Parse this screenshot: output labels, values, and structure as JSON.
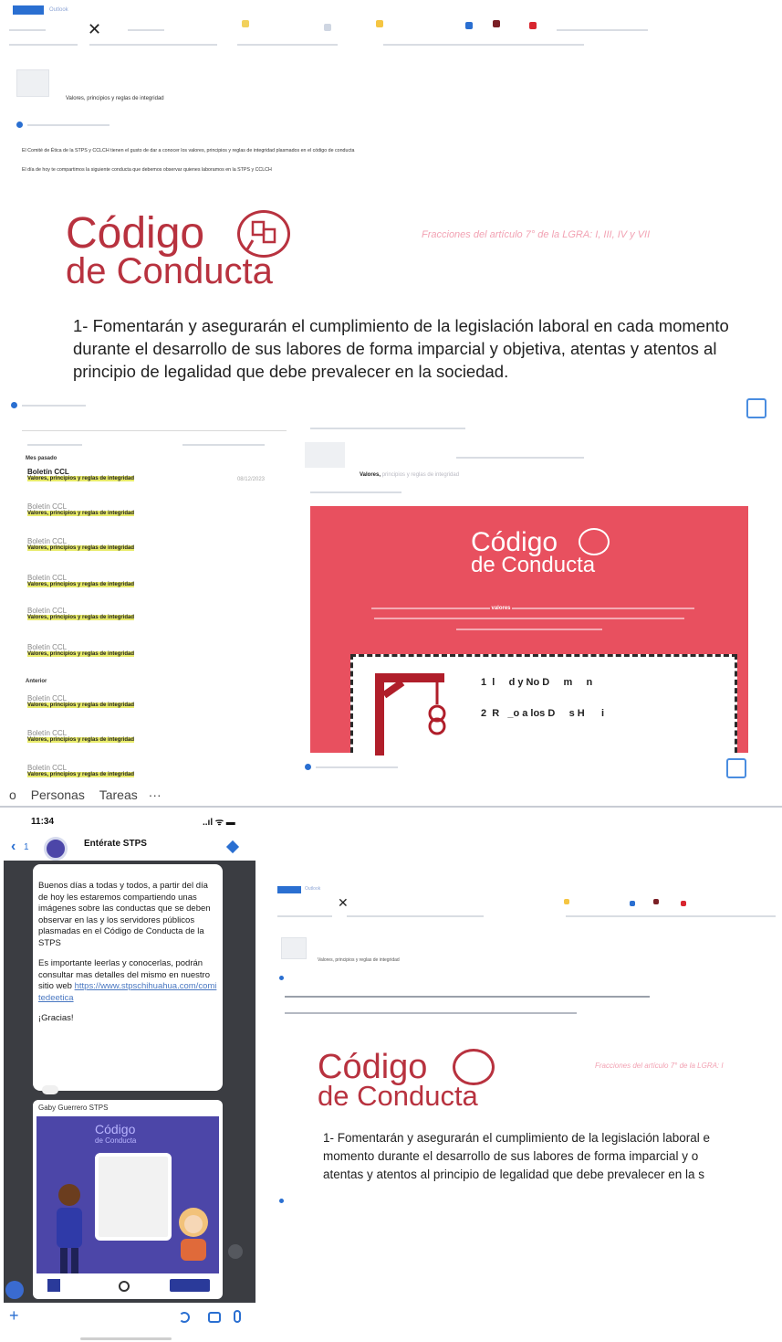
{
  "top_screenshot": {
    "app_badge": "Outlook",
    "ribbon_close": "✕",
    "email_subject": "Valores, principios y reglas de integridad",
    "body_line1": "El Comité de Ética de la STPS y CCLCH tienen el gusto de dar a conocer los valores, principios y reglas de integridad plasmados en el código de conducta",
    "body_line2": "El día de hoy te compartimos la siguiente conducta que debemos observar quienes laboramos en la STPS y CCLCH",
    "logo_line1": "Código",
    "logo_line2": "de Conducta",
    "fractions_note": "Fracciones del artículo 7° de la LGRA: I, III, IV y VII",
    "conduct_text": "1- Fomentarán y asegurarán el cumplimiento de la legislación laboral en cada momento durante el desarrollo de sus labores de forma imparcial y objetiva, atentas y atentos al principio de legalidad que debe prevalecer en la sociedad."
  },
  "middle_screenshot": {
    "group_last_month": "Mes pasado",
    "group_older": "Anterior",
    "emails": [
      {
        "sender": "Boletín CCL",
        "subject": "Valores, principios y reglas de integridad",
        "date": "08/12/2023",
        "bold": true
      },
      {
        "sender": "Boletín CCL",
        "subject": "Valores, principios y reglas de integridad",
        "date": "",
        "bold": false
      },
      {
        "sender": "Boletín CCL",
        "subject": "Valores, principios y reglas de integridad",
        "date": "",
        "bold": false
      },
      {
        "sender": "Boletín CCL",
        "subject": "Valores, principios y reglas de integridad",
        "date": "",
        "bold": false
      },
      {
        "sender": "Boletín CCL",
        "subject": "Valores, principios y reglas de integridad",
        "date": "",
        "bold": false
      },
      {
        "sender": "Boletín CCL",
        "subject": "Valores, principios y reglas de integridad",
        "date": "",
        "bold": false
      },
      {
        "sender": "Boletín CCL",
        "subject": "Valores, principios y reglas de integridad",
        "date": "",
        "bold": false
      },
      {
        "sender": "Boletín CCL",
        "subject": "Valores, principios y reglas de integridad",
        "date": "",
        "bold": false
      },
      {
        "sender": "Boletín CCL",
        "subject": "Valores, principios y reglas de integridad",
        "date": "",
        "bold": false
      }
    ],
    "reading_subject_bold": "Valores,",
    "reading_subject_rest": "principios y reglas de integridad",
    "banner_logo_line1": "Código",
    "banner_logo_line2": "de Conducta",
    "banner_text_bold": "valores",
    "hangman_row1": "1  l     d y No D     m     n",
    "hangman_row2": "2  R   _o a los D     s H      i",
    "bottom_nav": [
      "Personas",
      "Tareas",
      "···"
    ],
    "bottom_nav_prefix": "o"
  },
  "phone": {
    "time": "11:34",
    "status_icons": "..ıl ᯤ ▬",
    "back_label": "1",
    "channel_name": "Entérate STPS",
    "message_p1": "Buenos días a todas y todos, a partir del día de hoy les estaremos compartiendo unas imágenes sobre las conductas que se deben observar en las y los servidores públicos plasmadas en el Código de Conducta de la STPS",
    "message_p2_pre": "Es importante leerlas y conocerlas, podrán consultar mas detalles del mismo en nuestro sitio web",
    "message_link": "https://www.stpschihuahua.com/comitedeetica",
    "message_thanks": "¡Gracias!",
    "forward_sender": "Gaby Guerrero STPS",
    "card_logo_line1": "Código",
    "card_logo_line2": "de Conducta",
    "plus": "+"
  },
  "bottom_screenshot": {
    "app_badge": "Outlook",
    "ribbon_close": "✕",
    "email_subject": "Valores, principios y reglas de integridad",
    "logo_line1": "Código",
    "logo_line2": "de Conducta",
    "fractions_note": "Fracciones del artículo 7° de la LGRA: I",
    "conduct_line1": "1- Fomentarán y asegurarán el cumplimiento de la legislación laboral e",
    "conduct_line2": "momento durante el desarrollo de sus labores de forma imparcial y o",
    "conduct_line3": "atentas y atentos al principio de legalidad que debe prevalecer en la s"
  },
  "colors": {
    "brand_red": "#b8323f",
    "banner_pink": "#e8505f",
    "outlook_blue": "#2a6fd1",
    "phone_bg": "#3b3d42",
    "card_purple": "#4c46a8"
  }
}
